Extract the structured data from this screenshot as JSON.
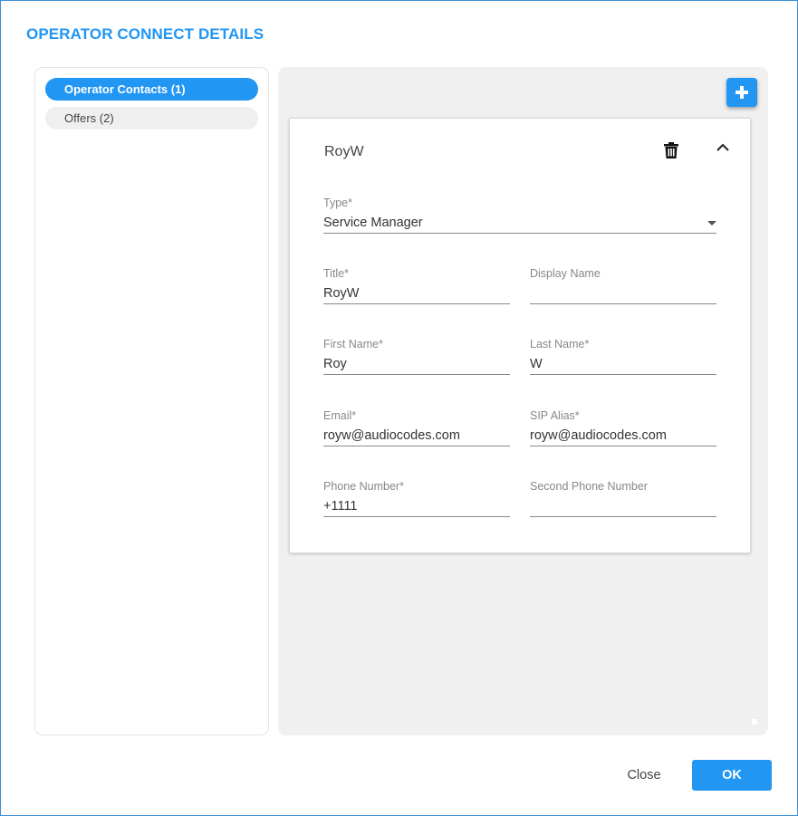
{
  "dialog": {
    "title": "OPERATOR CONNECT DETAILS"
  },
  "nav": {
    "items": [
      {
        "label": "Operator Contacts (1)",
        "active": true
      },
      {
        "label": "Offers (2)",
        "active": false
      }
    ]
  },
  "toolbar": {
    "add_icon": "plus-icon"
  },
  "contact": {
    "title": "RoyW",
    "icons": {
      "delete": "trash-icon",
      "collapse": "chevron-up-icon"
    },
    "fields": {
      "type": {
        "label": "Type*",
        "value": "Service Manager"
      },
      "title": {
        "label": "Title*",
        "value": "RoyW"
      },
      "display_name": {
        "label": "Display Name",
        "value": ""
      },
      "first_name": {
        "label": "First Name*",
        "value": "Roy"
      },
      "last_name": {
        "label": "Last Name*",
        "value": "W"
      },
      "email": {
        "label": "Email*",
        "value": "royw@audiocodes.com"
      },
      "sip_alias": {
        "label": "SIP Alias*",
        "value": "royw@audiocodes.com"
      },
      "phone": {
        "label": "Phone Number*",
        "value": "+1111"
      },
      "second_phone": {
        "label": "Second Phone Number",
        "value": ""
      }
    }
  },
  "footer": {
    "close_label": "Close",
    "ok_label": "OK"
  },
  "colors": {
    "accent": "#2196f3",
    "panel_bg": "#f0f0f0"
  }
}
